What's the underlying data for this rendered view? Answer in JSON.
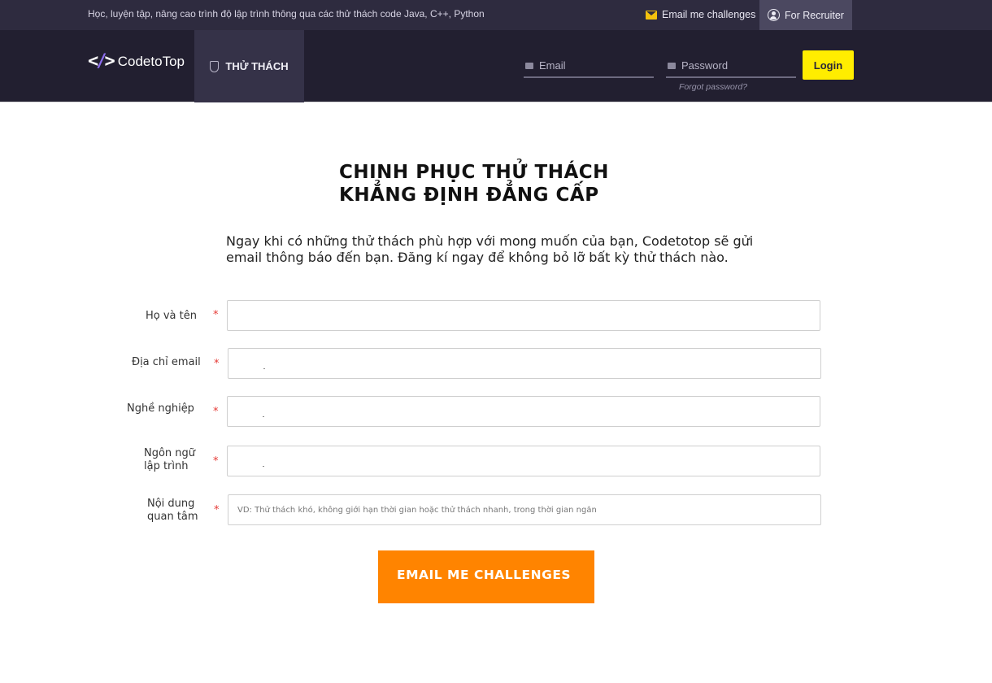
{
  "topbar": {
    "tagline": "Học, luyện tập, nâng cao trình độ lập trình thông qua các thử thách code Java, C++, Python",
    "email_challenges": "Email me challenges",
    "for_recruiter": "For Recruiter"
  },
  "nav": {
    "logo_text": "CodetoTop",
    "tab_label": "THỬ THÁCH",
    "email_placeholder": "Email",
    "password_placeholder": "Password",
    "forgot": "Forgot password?",
    "login": "Login"
  },
  "content": {
    "headline_1": "CHINH PHỤC THỬ THÁCH",
    "headline_2": "KHẲNG ĐỊNH ĐẲNG CẤP",
    "intro": "Ngay khi có những thử thách phù hợp với mong muốn của bạn, Codetotop sẽ gửi email thông báo đến bạn. Đăng kí ngay để không bỏ lỡ bất kỳ thử thách nào."
  },
  "form": {
    "required_mark": "*",
    "fields": [
      {
        "label": "Họ và tên",
        "placeholder": ""
      },
      {
        "label": "Địa chỉ email",
        "placeholder": ""
      },
      {
        "label": "Nghề nghiệp",
        "placeholder": ""
      },
      {
        "label": "Ngôn ngữ lập trình",
        "placeholder": ""
      },
      {
        "label": "Nội dung quan tâm",
        "placeholder": "VD: Thử thách khó, không giới hạn thời gian hoặc thử thách nhanh, trong thời gian ngắn"
      }
    ],
    "submit": "EMAIL ME CHALLENGES"
  }
}
